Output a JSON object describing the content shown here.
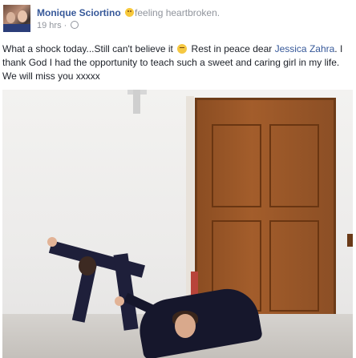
{
  "post": {
    "author": "Monique Sciortino",
    "feeling_text": "feeling heartbroken.",
    "timestamp": "19 hrs",
    "separator": "·",
    "text_before_emoji": "What a shock today...Still can't believe it",
    "text_after_emoji": " Rest in peace dear ",
    "tagged_person": "Jessica Zahra",
    "text_end": ". I thank God I had the opportunity to teach such a sweet and caring girl in my life. We will miss you xxxxx"
  },
  "icons": {
    "feeling": "heartbroken-face-icon",
    "inline_emoji": "sad-face-icon",
    "privacy": "globe-icon"
  },
  "colors": {
    "link": "#365899",
    "meta": "#90949c",
    "text": "#1d2129"
  }
}
